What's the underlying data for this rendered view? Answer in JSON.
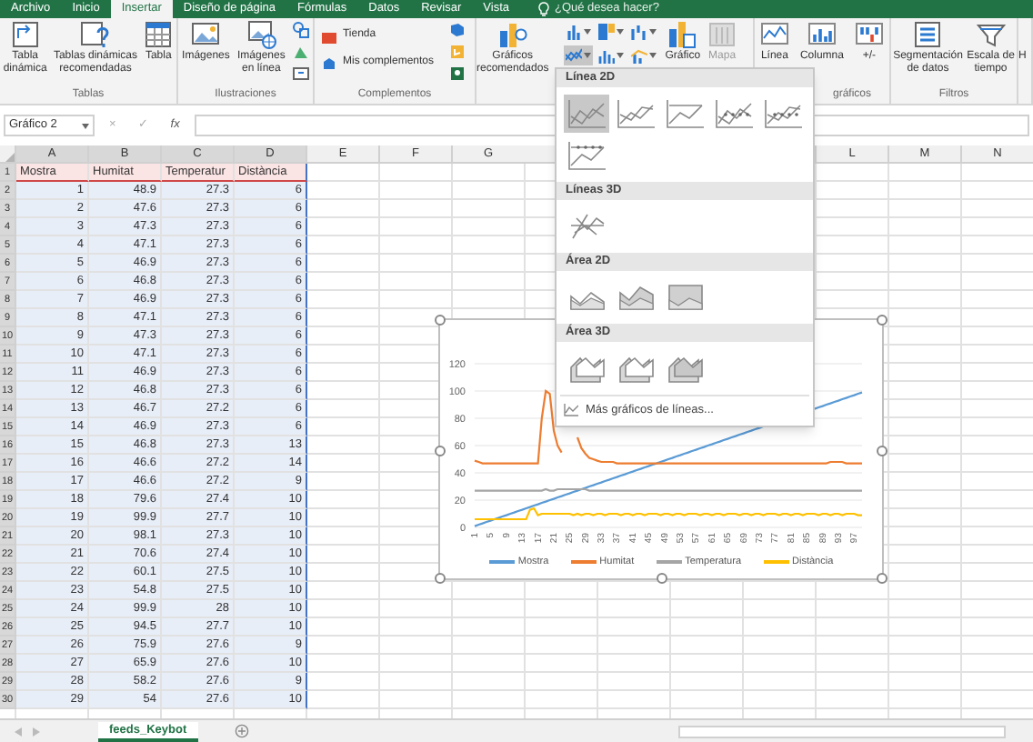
{
  "ribbon_tabs": [
    {
      "label": "Archivo",
      "selected": false
    },
    {
      "label": "Inicio",
      "selected": false
    },
    {
      "label": "Insertar",
      "selected": true
    },
    {
      "label": "Diseño de página",
      "selected": false
    },
    {
      "label": "Fórmulas",
      "selected": false
    },
    {
      "label": "Datos",
      "selected": false
    },
    {
      "label": "Revisar",
      "selected": false
    },
    {
      "label": "Vista",
      "selected": false
    }
  ],
  "tell_me": {
    "placeholder": "¿Qué desea hacer?"
  },
  "ribbon_groups": [
    {
      "label": "Tablas",
      "items": [
        {
          "kind": "large",
          "label": "Tabla\ndinámica"
        },
        {
          "kind": "large",
          "label": "Tablas dinámicas\nrecomendadas"
        },
        {
          "kind": "large",
          "label": "Tabla"
        }
      ]
    },
    {
      "label": "Ilustraciones",
      "items": [
        {
          "kind": "large",
          "label": "Imágenes"
        },
        {
          "kind": "large",
          "label": "Imágenes\nen línea"
        },
        {
          "kind": "icons"
        }
      ]
    },
    {
      "label": "Complementos",
      "items": [
        {
          "kind": "list",
          "entries": [
            "Tienda",
            "Mis complementos"
          ]
        },
        {
          "kind": "icons"
        }
      ]
    },
    {
      "items": [
        {
          "kind": "large",
          "label": "Gráficos\nrecomendados",
          "disabled": false
        },
        {
          "kind": "chart_grid",
          "buttons": [
            {
              "selected": false
            },
            {
              "selected": false
            },
            {
              "selected": false
            },
            {
              "selected": true
            },
            {
              "selected": false
            },
            {
              "selected": false
            }
          ]
        },
        {
          "kind": "large",
          "label": "Gráfico",
          "disabled": false
        },
        {
          "kind": "large",
          "label": "Mapa",
          "disabled": true
        }
      ]
    },
    {
      "label": "gráficos",
      "items": [
        {
          "kind": "large",
          "label": "Línea"
        },
        {
          "kind": "large",
          "label": "Columna"
        },
        {
          "kind": "large",
          "label": "+/-"
        }
      ]
    },
    {
      "label": "Filtros",
      "items": [
        {
          "kind": "large",
          "label": "Segmentación\nde datos"
        },
        {
          "kind": "large",
          "label": "Escala de\ntiempo"
        }
      ]
    },
    {
      "items": [
        {
          "kind": "large",
          "label": "H"
        }
      ]
    }
  ],
  "formula_bar": {
    "name_box": "Gráfico 2",
    "cancel": "×",
    "enter": "✓",
    "function": "fx"
  },
  "sheet": {
    "highlighted": true,
    "columns": [
      "A",
      "B",
      "C",
      "D",
      "E",
      "F",
      "G"
    ],
    "columns_right": [
      "L",
      "M",
      "N"
    ],
    "header_row": {
      "number": "1",
      "cells": [
        "Mostra",
        "Humitat",
        "Temperatur",
        "Distància"
      ]
    },
    "rows": [
      {
        "number": "2",
        "cells": [
          "1",
          "48.9",
          "27.3",
          "6"
        ]
      },
      {
        "number": "3",
        "cells": [
          "2",
          "47.6",
          "27.3",
          "6"
        ]
      },
      {
        "number": "4",
        "cells": [
          "3",
          "47.3",
          "27.3",
          "6"
        ]
      },
      {
        "number": "5",
        "cells": [
          "4",
          "47.1",
          "27.3",
          "6"
        ]
      },
      {
        "number": "6",
        "cells": [
          "5",
          "46.9",
          "27.3",
          "6"
        ]
      },
      {
        "number": "7",
        "cells": [
          "6",
          "46.8",
          "27.3",
          "6"
        ]
      },
      {
        "number": "8",
        "cells": [
          "7",
          "46.9",
          "27.3",
          "6"
        ]
      },
      {
        "number": "9",
        "cells": [
          "8",
          "47.1",
          "27.3",
          "6"
        ]
      },
      {
        "number": "10",
        "cells": [
          "9",
          "47.3",
          "27.3",
          "6"
        ]
      },
      {
        "number": "11",
        "cells": [
          "10",
          "47.1",
          "27.3",
          "6"
        ]
      },
      {
        "number": "12",
        "cells": [
          "11",
          "46.9",
          "27.3",
          "6"
        ]
      },
      {
        "number": "13",
        "cells": [
          "12",
          "46.8",
          "27.3",
          "6"
        ]
      },
      {
        "number": "14",
        "cells": [
          "13",
          "46.7",
          "27.2",
          "6"
        ]
      },
      {
        "number": "15",
        "cells": [
          "14",
          "46.9",
          "27.3",
          "6"
        ]
      },
      {
        "number": "16",
        "cells": [
          "15",
          "46.8",
          "27.3",
          "13"
        ]
      },
      {
        "number": "17",
        "cells": [
          "16",
          "46.6",
          "27.2",
          "14"
        ]
      },
      {
        "number": "18",
        "cells": [
          "17",
          "46.6",
          "27.2",
          "9"
        ]
      },
      {
        "number": "19",
        "cells": [
          "18",
          "79.6",
          "27.4",
          "10"
        ]
      },
      {
        "number": "20",
        "cells": [
          "19",
          "99.9",
          "27.7",
          "10"
        ]
      },
      {
        "number": "21",
        "cells": [
          "20",
          "98.1",
          "27.3",
          "10"
        ]
      },
      {
        "number": "22",
        "cells": [
          "21",
          "70.6",
          "27.4",
          "10"
        ]
      },
      {
        "number": "23",
        "cells": [
          "22",
          "60.1",
          "27.5",
          "10"
        ]
      },
      {
        "number": "24",
        "cells": [
          "23",
          "54.8",
          "27.5",
          "10"
        ]
      },
      {
        "number": "25",
        "cells": [
          "24",
          "99.9",
          "28",
          "10"
        ]
      },
      {
        "number": "26",
        "cells": [
          "25",
          "94.5",
          "27.7",
          "10"
        ]
      },
      {
        "number": "27",
        "cells": [
          "26",
          "75.9",
          "27.6",
          "9"
        ]
      },
      {
        "number": "28",
        "cells": [
          "27",
          "65.9",
          "27.6",
          "10"
        ]
      },
      {
        "number": "29",
        "cells": [
          "28",
          "58.2",
          "27.6",
          "9"
        ]
      },
      {
        "number": "30",
        "cells": [
          "29",
          "54",
          "27.6",
          "10"
        ]
      }
    ]
  },
  "chart": {
    "chart_data": {
      "type": "line",
      "grid": true,
      "xlim": [
        1,
        99
      ],
      "ylim": [
        0,
        120
      ],
      "yticks": [
        0,
        20,
        40,
        60,
        80,
        100,
        120
      ],
      "x": [
        1,
        2,
        3,
        4,
        5,
        6,
        7,
        8,
        9,
        10,
        11,
        12,
        13,
        14,
        15,
        16,
        17,
        18,
        19,
        20,
        21,
        22,
        23,
        24,
        25,
        26,
        27,
        28,
        29,
        30,
        31,
        32,
        33,
        34,
        35,
        36,
        37,
        38,
        39,
        40,
        41,
        42,
        43,
        44,
        45,
        46,
        47,
        48,
        49,
        50,
        51,
        52,
        53,
        54,
        55,
        56,
        57,
        58,
        59,
        60,
        61,
        62,
        63,
        64,
        65,
        66,
        67,
        68,
        69,
        70,
        71,
        72,
        73,
        74,
        75,
        76,
        77,
        78,
        79,
        80,
        81,
        82,
        83,
        84,
        85,
        86,
        87,
        88,
        89,
        90,
        91,
        92,
        93,
        94,
        95,
        96,
        97,
        98,
        99
      ],
      "xticks": [
        1,
        5,
        9,
        13,
        17,
        21,
        25,
        29,
        33,
        37,
        41,
        45,
        49,
        53,
        57,
        61,
        65,
        69,
        73,
        77,
        81,
        85,
        89,
        93,
        97
      ],
      "series": [
        {
          "name": "Mostra",
          "color": "#5b9bd5",
          "values": [
            1,
            2,
            3,
            4,
            5,
            6,
            7,
            8,
            9,
            10,
            11,
            12,
            13,
            14,
            15,
            16,
            17,
            18,
            19,
            20,
            21,
            22,
            23,
            24,
            25,
            26,
            27,
            28,
            29,
            30,
            31,
            32,
            33,
            34,
            35,
            36,
            37,
            38,
            39,
            40,
            41,
            42,
            43,
            44,
            45,
            46,
            47,
            48,
            49,
            50,
            51,
            52,
            53,
            54,
            55,
            56,
            57,
            58,
            59,
            60,
            61,
            62,
            63,
            64,
            65,
            66,
            67,
            68,
            69,
            70,
            71,
            72,
            73,
            74,
            null,
            null,
            null,
            null,
            null,
            null,
            null,
            null,
            null,
            null,
            null,
            null,
            87,
            88,
            89,
            90,
            91,
            92,
            93,
            94,
            95,
            96,
            97,
            98,
            99
          ]
        },
        {
          "name": "Humitat",
          "color": "#ed7d31",
          "values": [
            49,
            48,
            47,
            47,
            47,
            47,
            47,
            47,
            47,
            47,
            47,
            47,
            47,
            47,
            47,
            47,
            47,
            80,
            100,
            98,
            71,
            60,
            55,
            null,
            null,
            null,
            66,
            58,
            54,
            51,
            50,
            49,
            48,
            48,
            48,
            48,
            47,
            47,
            47,
            47,
            47,
            47,
            47,
            47,
            47,
            47,
            47,
            47,
            47,
            47,
            47,
            47,
            47,
            47,
            47,
            47,
            47,
            47,
            47,
            47,
            47,
            47,
            47,
            47,
            47,
            47,
            47,
            47,
            47,
            47,
            47,
            47,
            47,
            47,
            47,
            47,
            47,
            47,
            47,
            47,
            47,
            47,
            47,
            47,
            47,
            47,
            47,
            47,
            47,
            47,
            48,
            48,
            48,
            48,
            47,
            47,
            47,
            47,
            47
          ]
        },
        {
          "name": "Temperatura",
          "color": "#a5a5a5",
          "values": [
            27,
            27,
            27,
            27,
            27,
            27,
            27,
            27,
            27,
            27,
            27,
            27,
            27,
            27,
            27,
            27,
            27,
            27,
            28,
            27,
            27,
            28,
            28,
            28,
            28,
            28,
            28,
            28,
            28,
            27,
            27,
            27,
            27,
            27,
            27,
            27,
            27,
            27,
            27,
            27,
            27,
            27,
            27,
            27,
            27,
            27,
            27,
            27,
            27,
            27,
            27,
            27,
            27,
            27,
            27,
            27,
            27,
            27,
            27,
            27,
            27,
            27,
            27,
            27,
            27,
            27,
            27,
            27,
            27,
            27,
            27,
            27,
            27,
            27,
            27,
            27,
            27,
            27,
            27,
            27,
            27,
            27,
            27,
            27,
            27,
            27,
            27,
            27,
            27,
            27,
            27,
            27,
            27,
            27,
            27,
            27,
            27,
            27,
            27
          ]
        },
        {
          "name": "Distància",
          "color": "#ffc000",
          "values": [
            6,
            6,
            6,
            6,
            6,
            6,
            6,
            6,
            6,
            6,
            6,
            6,
            6,
            6,
            13,
            14,
            9,
            10,
            10,
            10,
            10,
            10,
            10,
            10,
            10,
            9,
            10,
            9,
            10,
            10,
            9,
            10,
            10,
            9,
            10,
            10,
            10,
            9,
            10,
            10,
            9,
            10,
            10,
            9,
            10,
            10,
            10,
            9,
            10,
            10,
            9,
            10,
            10,
            9,
            10,
            10,
            10,
            9,
            10,
            10,
            9,
            10,
            10,
            9,
            10,
            10,
            10,
            9,
            10,
            10,
            9,
            10,
            10,
            9,
            10,
            10,
            10,
            9,
            10,
            10,
            9,
            10,
            10,
            9,
            10,
            10,
            10,
            9,
            10,
            10,
            9,
            10,
            10,
            9,
            10,
            10,
            10,
            9,
            9
          ]
        }
      ]
    }
  },
  "line_menu": {
    "sections": [
      {
        "title": "Línea 2D",
        "options": [
          {
            "selected": true
          },
          {
            "selected": false
          },
          {
            "selected": false
          },
          {
            "selected": false
          },
          {
            "selected": false
          },
          {
            "selected": false
          }
        ]
      },
      {
        "title": "Líneas 3D",
        "options": [
          {
            "selected": false
          }
        ]
      },
      {
        "title": "Área 2D",
        "options": [
          {
            "selected": false
          },
          {
            "selected": false
          },
          {
            "selected": false
          }
        ]
      },
      {
        "title": "Área 3D",
        "options": [
          {
            "selected": false
          },
          {
            "selected": false
          },
          {
            "selected": false
          }
        ]
      }
    ],
    "more": "Más gráficos de líneas..."
  },
  "sheet_tabs": [
    {
      "label": "feeds_Keybot",
      "selected": true
    }
  ]
}
